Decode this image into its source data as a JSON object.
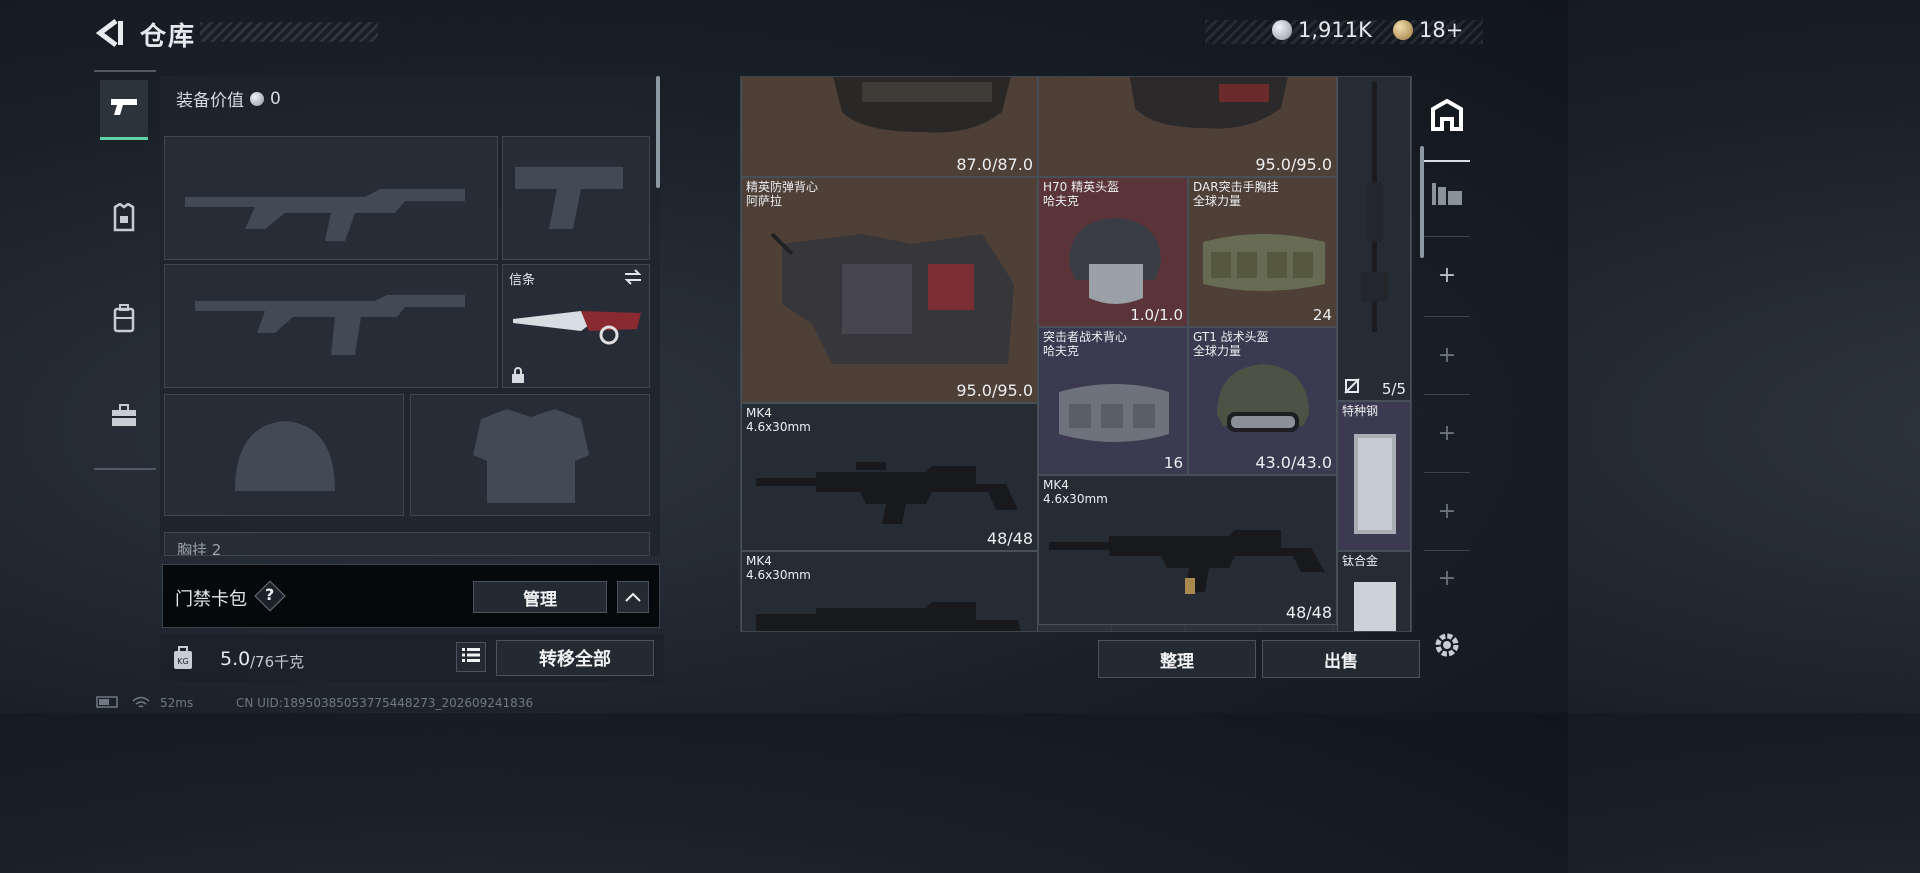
{
  "header": {
    "title": "仓库",
    "silver_amount": "1,911K",
    "gold_amount": "18+"
  },
  "loadout": {
    "value_label": "装备价值",
    "value_amount": "0",
    "melee_slot_label": "信条",
    "chest_label_partial": "胸挂  2"
  },
  "keycard": {
    "label": "门禁卡包",
    "help": "?",
    "manage_button": "管理"
  },
  "weight": {
    "current": "5.0",
    "max_unit": "/76千克",
    "transfer_all_button": "转移全部"
  },
  "stash": {
    "items": [
      {
        "name": "",
        "value": "87.0/87.0",
        "type": "vest-top-a"
      },
      {
        "name": "",
        "value": "95.0/95.0",
        "type": "vest-top-b"
      },
      {
        "name": "精英防弹背心\n阿萨拉",
        "value": "95.0/95.0",
        "type": "armor-vest"
      },
      {
        "name": "H70 精英头盔\n哈夫克",
        "value": "1.0/1.0",
        "type": "helmet-red"
      },
      {
        "name": "DAR突击手胸挂\n全球力量",
        "value": "24",
        "type": "chest-rig"
      },
      {
        "name": "突击者战术背心\n哈夫克",
        "value": "16",
        "type": "tactical-vest"
      },
      {
        "name": "GT1 战术头盔\n全球力量",
        "value": "43.0/43.0",
        "type": "helmet-green"
      },
      {
        "name": "MK4\n4.6x30mm",
        "value": "48/48",
        "type": "smg"
      },
      {
        "name": "MK4\n4.6x30mm",
        "value": "48/48",
        "type": "smg"
      },
      {
        "name": "MK4\n4.6x30mm",
        "value": "",
        "type": "smg"
      },
      {
        "name": "",
        "value": "5/5",
        "type": "sniper"
      },
      {
        "name": "特种钢",
        "value": "",
        "type": "steel"
      },
      {
        "name": "钛合金",
        "value": "",
        "type": "titanium"
      }
    ]
  },
  "actions": {
    "sort_button": "整理",
    "sell_button": "出售"
  },
  "status_bar": {
    "ping": "52ms",
    "uid": "CN UID:18950385053775448273_202609241836"
  },
  "colors": {
    "accent": "#5fd2a8",
    "brown_cell": "#4e3f37",
    "red_cell": "#5a3438",
    "purple_cell": "#3b3a50"
  }
}
